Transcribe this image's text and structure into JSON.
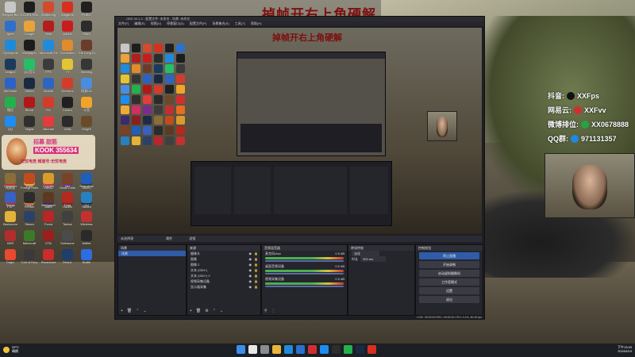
{
  "overlay_title": "掉帧开右上角硬解",
  "desktop": {
    "icons": [
      {
        "label": "Recycle Bin",
        "color": "#c7c7c7"
      },
      {
        "label": "ELDEN RING",
        "color": "#1e1e1e"
      },
      {
        "label": "Wuthering",
        "color": "#d14b2c"
      },
      {
        "label": "Wegame",
        "color": "#d7301f"
      },
      {
        "label": "PUBG",
        "color": "#202020"
      },
      {
        "label": "Apex",
        "color": "#3070c9"
      },
      {
        "label": "Google",
        "color": "#e8a33a"
      },
      {
        "label": "Hunt",
        "color": "#b21e1e"
      },
      {
        "label": "Adobe",
        "color": "#c91d1d"
      },
      {
        "label": "Paint",
        "color": "#2c2c2c"
      },
      {
        "label": "Cyberpunk",
        "color": "#1d8bd9"
      },
      {
        "label": "Wallpaper",
        "color": "#1c1c1c"
      },
      {
        "label": "Microsoft Edge",
        "color": "#1f8bdd"
      },
      {
        "label": "Overwatch",
        "color": "#e08b2c"
      },
      {
        "label": "The Long Dark",
        "color": "#6a3d2b"
      },
      {
        "label": "League",
        "color": "#1b3a5c"
      },
      {
        "label": "QQ音乐",
        "color": "#25c066"
      },
      {
        "label": "FPS",
        "color": "#3b3b3b"
      },
      {
        "label": "YY",
        "color": "#e2c434"
      },
      {
        "label": "Warning",
        "color": "#363636"
      },
      {
        "label": "WeGame",
        "color": "#2b62c7"
      },
      {
        "label": "Steam",
        "color": "#1a2a44"
      },
      {
        "label": "Mobile",
        "color": "#2d66c2"
      },
      {
        "label": "Demons",
        "color": "#d33c2b"
      },
      {
        "label": "网易UU",
        "color": "#4a8de0"
      },
      {
        "label": "微信",
        "color": "#22b14c"
      },
      {
        "label": "Blood",
        "color": "#b01818"
      },
      {
        "label": "EA",
        "color": "#d33b2b"
      },
      {
        "label": "Cursor",
        "color": "#202020"
      },
      {
        "label": "斗鱼",
        "color": "#f2a32a"
      },
      {
        "label": "QQ",
        "color": "#1e8cf0"
      },
      {
        "label": "Vegas",
        "color": "#2f2f2f"
      },
      {
        "label": "Valorant",
        "color": "#e23c3c"
      },
      {
        "label": "Unity",
        "color": "#2b2b2b"
      },
      {
        "label": "Knight",
        "color": "#6b4a2c"
      },
      {
        "label": "网易云",
        "color": "#d12f2f"
      },
      {
        "label": "Foreign Kittens",
        "color": "#eda93a"
      },
      {
        "label": "IntelliJ",
        "color": "#cf2e65"
      },
      {
        "label": "Dead Cells",
        "color": "#7b2b8f"
      },
      {
        "label": "Sekiro",
        "color": "#3c3c3c"
      },
      {
        "label": "PSP",
        "color": "#c12f2f"
      },
      {
        "label": "Firefox",
        "color": "#e96c22"
      },
      {
        "label": "Astro",
        "color": "#3c2a6e"
      },
      {
        "label": "Hades",
        "color": "#8a1f1f"
      },
      {
        "label": "Steam",
        "color": "#1d2b46"
      },
      {
        "label": "Crusader",
        "color": "#8b6d3a"
      },
      {
        "label": "Rust",
        "color": "#c24a1f"
      },
      {
        "label": "Counter",
        "color": "#d99b2c"
      },
      {
        "label": "Mu",
        "color": "#7a4226"
      },
      {
        "label": "Seamless",
        "color": "#1f5fba"
      },
      {
        "label": "Teams",
        "color": "#3761c2"
      },
      {
        "label": "DayZ",
        "color": "#2b2b2b"
      },
      {
        "label": "Wallpaper",
        "color": "#5c3a22"
      },
      {
        "label": "Dota",
        "color": "#b32a1e"
      },
      {
        "label": "Ori",
        "color": "#2a7fbd"
      },
      {
        "label": "Backroom",
        "color": "#e0b33a"
      },
      {
        "label": "Steam",
        "color": "#2b4168"
      },
      {
        "label": "Forza",
        "color": "#b8262a"
      },
      {
        "label": "Tarkov",
        "color": "#404040"
      },
      {
        "label": "Wireless",
        "color": "#c23131"
      },
      {
        "label": "HDR",
        "color": "#b32d2d"
      },
      {
        "label": "Minecraft",
        "color": "#3c7a2a"
      },
      {
        "label": "GTA",
        "color": "#9a1f1f"
      },
      {
        "label": "Deltarune",
        "color": "#4b4b4b"
      },
      {
        "label": "Wallet",
        "color": "#2a2a2a"
      },
      {
        "label": "Origin",
        "color": "#e84a2f"
      },
      {
        "label": "Call of Duty",
        "color": "#3a3a3a"
      },
      {
        "label": "Broadcast",
        "color": "#cb2c2c"
      },
      {
        "label": "DeepL",
        "color": "#1f3e6a"
      },
      {
        "label": "Battle",
        "color": "#2c6ee0"
      }
    ],
    "sticker_line1": "招募  甜筋",
    "sticker_line2": "KOOK 355634",
    "sticker_line3": "无忧电竞  频道号:无忧电竞"
  },
  "stream_overlay": {
    "rows": [
      {
        "label": "抖音:",
        "value": "XXFps",
        "color": "#111111"
      },
      {
        "label": "网易云:",
        "value": "XXFvv",
        "color": "#d12f2f"
      },
      {
        "label": "微博排位:",
        "value": "XX0678888",
        "color": "#25a244"
      },
      {
        "label": "QQ群:",
        "value": "971131357",
        "color": "#1e88e5"
      }
    ]
  },
  "obs": {
    "title": "OBS 30.1.2 - 配置文件: 未命名 - 场景: 未命名",
    "menu": [
      "文件(F)",
      "编辑(E)",
      "视图(V)",
      "停靠窗口(D)",
      "配置文件(P)",
      "场景集合(S)",
      "工具(T)",
      "帮助(H)"
    ],
    "preview_tabs": [
      "未选择源",
      "属性",
      "滤镜"
    ],
    "scenes_header": "场景",
    "scenes": [
      "场景"
    ],
    "sources_header": "来源",
    "sources": [
      "摄像头",
      "图像",
      "图像 2",
      "文本 (GDI+)",
      "文本 (GDI+) 2",
      "视频采集设备",
      "显示器采集"
    ],
    "mixer_header": "音频混音器",
    "mixer": [
      {
        "name": "麦克风/Aux",
        "db": "0.0 dB"
      },
      {
        "name": "桌面音频设备",
        "db": "0.0 dB"
      },
      {
        "name": "视频采集设备",
        "db": "0.0 dB"
      }
    ],
    "transitions_header": "转场特效",
    "transition_name": "淡化",
    "transition_duration_label": "时长",
    "transition_duration": "300 ms",
    "controls_header": "控制按钮",
    "controls": [
      "停止直播",
      "开始录制",
      "启动虚拟摄像机",
      "工作室模式",
      "设置",
      "退出"
    ],
    "status": "LIVE: 00:00:00   REC: 00:00:00   CPU: 0.1%, 60.00 fps"
  },
  "taskbar": {
    "weather": "29°C",
    "weather_sub": "晴朗",
    "time": "下午13:40",
    "date": "2024/5/19",
    "apps": [
      {
        "name": "start",
        "color": "#3a8fe8"
      },
      {
        "name": "search",
        "color": "#e7e7e7"
      },
      {
        "name": "task-view",
        "color": "#8c8c8c"
      },
      {
        "name": "explorer",
        "color": "#e9b53a"
      },
      {
        "name": "edge",
        "color": "#1f8bdd"
      },
      {
        "name": "store",
        "color": "#2b6fd0"
      },
      {
        "name": "netease",
        "color": "#d12f2f"
      },
      {
        "name": "qq",
        "color": "#1e8cf0"
      },
      {
        "name": "obs",
        "color": "#2d2d2d"
      },
      {
        "name": "wechat",
        "color": "#22b14c"
      },
      {
        "name": "steam",
        "color": "#1a2a44"
      },
      {
        "name": "wegame",
        "color": "#d7301f"
      }
    ]
  }
}
